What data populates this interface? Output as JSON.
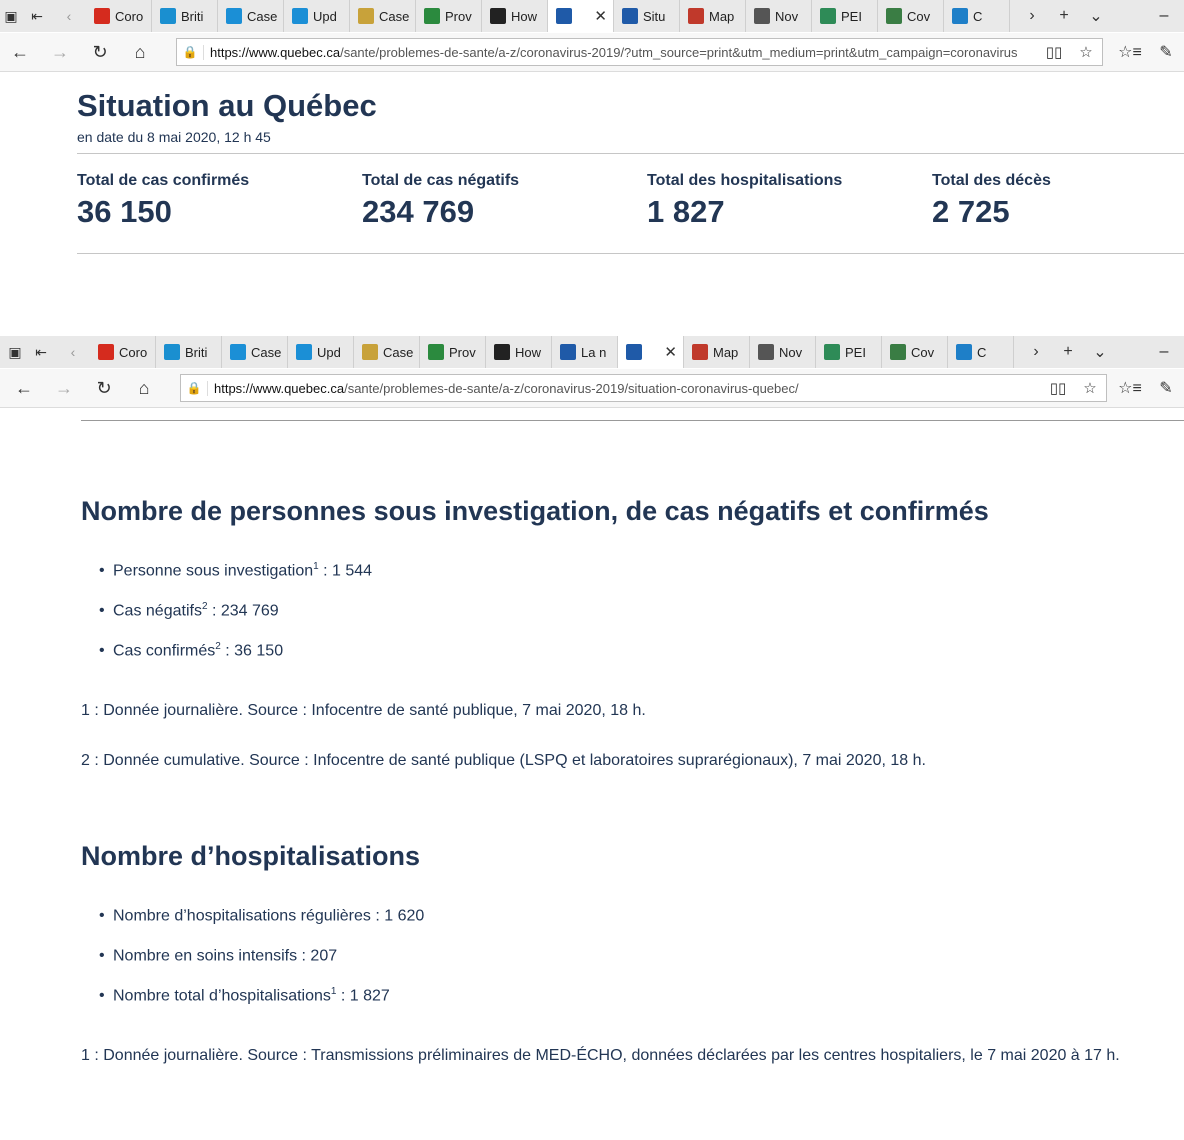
{
  "browser1": {
    "tabs": [
      {
        "label": "Coro",
        "fav": "canada-flag-icon",
        "color": "#d52b1e"
      },
      {
        "label": "Briti",
        "fav": "bc-icon",
        "color": "#1a8fd0"
      },
      {
        "label": "Case",
        "fav": "alberta-icon",
        "color": "#1b8fd6"
      },
      {
        "label": "Upd",
        "fav": "alberta-icon",
        "color": "#1b8fd6"
      },
      {
        "label": "Case",
        "fav": "doc-icon",
        "color": "#c8a23a"
      },
      {
        "label": "Prov",
        "fav": "green-banner-icon",
        "color": "#2b8a3e"
      },
      {
        "label": "How",
        "fav": "shield-icon",
        "color": "#222222"
      },
      {
        "label": "",
        "fav": "quebec-fleur-icon",
        "color": "#1f5aa8",
        "active": true
      },
      {
        "label": "Situ",
        "fav": "quebec-fleur-icon",
        "color": "#1f5aa8"
      },
      {
        "label": "Map",
        "fav": "map-icon",
        "color": "#c0392b"
      },
      {
        "label": "Nov",
        "fav": "mail-icon",
        "color": "#555555"
      },
      {
        "label": "PEI",
        "fav": "pei-icon",
        "color": "#2e8b57"
      },
      {
        "label": "Cov",
        "fav": "globe-icon",
        "color": "#3a7d44"
      },
      {
        "label": "C",
        "fav": "circle-icon",
        "color": "#1e7fc8"
      }
    ],
    "url_host": "https://www.quebec.ca",
    "url_path": "/sante/problemes-de-sante/a-z/coronavirus-2019/?utm_source=print&utm_medium=print&utm_campaign=coronavirus"
  },
  "browser2": {
    "tabs": [
      {
        "label": "Coro",
        "fav": "canada-flag-icon",
        "color": "#d52b1e"
      },
      {
        "label": "Briti",
        "fav": "bc-icon",
        "color": "#1a8fd0"
      },
      {
        "label": "Case",
        "fav": "alberta-icon",
        "color": "#1b8fd6"
      },
      {
        "label": "Upd",
        "fav": "alberta-icon",
        "color": "#1b8fd6"
      },
      {
        "label": "Case",
        "fav": "doc-icon",
        "color": "#c8a23a"
      },
      {
        "label": "Prov",
        "fav": "green-banner-icon",
        "color": "#2b8a3e"
      },
      {
        "label": "How",
        "fav": "shield-icon",
        "color": "#222222"
      },
      {
        "label": "La n",
        "fav": "quebec-fleur-icon",
        "color": "#1f5aa8"
      },
      {
        "label": "",
        "fav": "quebec-fleur-icon",
        "color": "#1f5aa8",
        "active": true
      },
      {
        "label": "Map",
        "fav": "map-icon",
        "color": "#c0392b"
      },
      {
        "label": "Nov",
        "fav": "mail-icon",
        "color": "#555555"
      },
      {
        "label": "PEI",
        "fav": "pei-icon",
        "color": "#2e8b57"
      },
      {
        "label": "Cov",
        "fav": "globe-icon",
        "color": "#3a7d44"
      },
      {
        "label": "C",
        "fav": "circle-icon",
        "color": "#1e7fc8"
      }
    ],
    "url_host": "https://www.quebec.ca",
    "url_path": "/sante/problemes-de-sante/a-z/coronavirus-2019/situation-coronavirus-quebec/"
  },
  "situation": {
    "title": "Situation au Québec",
    "date": "en date du 8 mai 2020, 12 h 45",
    "stats": [
      {
        "label": "Total de cas confirmés",
        "value": "36 150"
      },
      {
        "label": "Total de cas négatifs",
        "value": "234 769"
      },
      {
        "label": "Total des hospitalisations",
        "value": "1 827"
      },
      {
        "label": "Total des décès",
        "value": "2 725"
      }
    ]
  },
  "investigation": {
    "heading": "Nombre de personnes sous investigation, de cas négatifs et confirmés",
    "items": [
      {
        "label": "Personne sous investigation",
        "sup": "1",
        "value": " : 1 544"
      },
      {
        "label": "Cas négatifs",
        "sup": "2",
        "value": " : 234 769"
      },
      {
        "label": "Cas confirmés",
        "sup": "2",
        "value": " : 36 150"
      }
    ],
    "note1": "1 : Donnée journalière. Source : Infocentre de santé publique, 7 mai 2020, 18 h.",
    "note2": "2 : Donnée cumulative. Source : Infocentre de santé publique (LSPQ et laboratoires suprarégionaux), 7 mai 2020, 18 h."
  },
  "hospitalisations": {
    "heading": "Nombre d’hospitalisations",
    "items": [
      {
        "label": "Nombre d’hospitalisations régulières",
        "sup": "",
        "value": " : 1 620"
      },
      {
        "label": "Nombre en soins intensifs",
        "sup": "",
        "value": " : 207"
      },
      {
        "label": "Nombre total d’hospitalisations",
        "sup": "1",
        "value": " : 1 827"
      }
    ],
    "note1": "1 : Donnée journalière. Source : Transmissions préliminaires de MED-ÉCHO, données déclarées par les centres hospitaliers, le 7 mai 2020 à 17 h."
  }
}
